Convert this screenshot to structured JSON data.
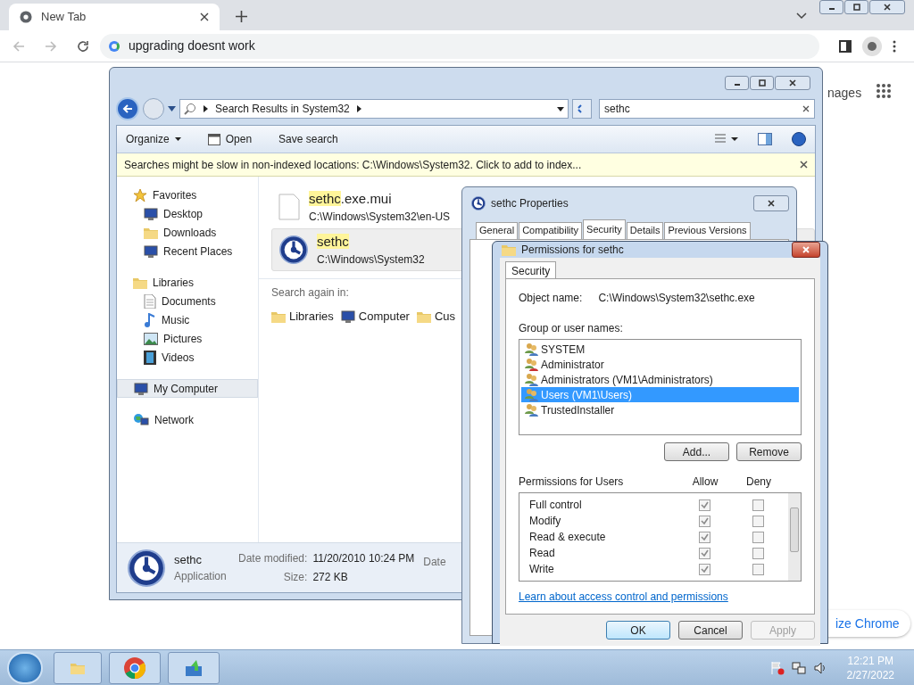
{
  "browser": {
    "tab": {
      "title": "New Tab"
    },
    "address": {
      "value": "upgrading doesnt work"
    },
    "page_texts": [
      {
        "kind": "top",
        "text": "nages"
      },
      {
        "kind": "pill",
        "text": "ize Chrome"
      }
    ]
  },
  "explorer": {
    "breadcrumb": "Search Results in System32",
    "search": {
      "value": "sethc"
    },
    "toolbar": [
      {
        "label": "Organize",
        "kind": "menu"
      },
      {
        "label": "Open",
        "kind": "icon"
      },
      {
        "label": "Save search",
        "kind": "plain"
      }
    ],
    "info_bar": "Searches might be slow in non-indexed locations: C:\\Windows\\System32. Click to add to index...",
    "nav": [
      {
        "label": "Favorites",
        "selected": false,
        "children": [
          {
            "label": "Desktop",
            "selected": false
          },
          {
            "label": "Downloads",
            "selected": false
          },
          {
            "label": "Recent Places",
            "selected": false
          }
        ]
      },
      {
        "label": "Libraries",
        "selected": false,
        "children": [
          {
            "label": "Documents",
            "selected": false
          },
          {
            "label": "Music",
            "selected": false
          },
          {
            "label": "Pictures",
            "selected": false
          },
          {
            "label": "Videos",
            "selected": false
          }
        ]
      },
      {
        "label": "My Computer",
        "selected": true
      },
      {
        "label": "Network",
        "selected": false
      }
    ],
    "results": [
      {
        "match": "sethc",
        "rest": ".exe.mui",
        "path": "C:\\Windows\\System32\\en-US",
        "kind": "file",
        "selected": false
      },
      {
        "match": "sethc",
        "path": "C:\\Windows\\System32",
        "kind": "app",
        "selected": true
      }
    ],
    "search_again": {
      "label": "Search again in:",
      "locations": [
        "Libraries",
        "Computer",
        "Cus"
      ]
    },
    "details": {
      "name": "sethc",
      "type": "Application",
      "fields": [
        {
          "label": "Date modified:",
          "value": "11/20/2010 10:24 PM"
        },
        {
          "label": "Size:",
          "value": "272 KB"
        }
      ],
      "cut_label": "Date"
    }
  },
  "properties": {
    "title": "sethc Properties",
    "tabs": [
      {
        "label": "General",
        "selected": false
      },
      {
        "label": "Compatibility",
        "selected": false
      },
      {
        "label": "Security",
        "selected": true
      },
      {
        "label": "Details",
        "selected": false
      },
      {
        "label": "Previous Versions",
        "selected": false
      }
    ]
  },
  "permissions": {
    "title": "Permissions for sethc",
    "tab": "Security",
    "object_label": "Object name:",
    "object_value": "C:\\Windows\\System32\\sethc.exe",
    "group_label": "Group or user names:",
    "users": [
      {
        "name": "SYSTEM",
        "selected": false
      },
      {
        "name": "Administrator",
        "selected": false
      },
      {
        "name": "Administrators (VM1\\Administrators)",
        "selected": false
      },
      {
        "name": "Users (VM1\\Users)",
        "selected": true
      },
      {
        "name": "TrustedInstaller",
        "selected": false
      }
    ],
    "list_buttons": [
      "Add...",
      "Remove"
    ],
    "perm_label": "Permissions for Users",
    "columns": [
      "Allow",
      "Deny"
    ],
    "rows": [
      {
        "name": "Full control",
        "allow": true,
        "deny": false
      },
      {
        "name": "Modify",
        "allow": true,
        "deny": false
      },
      {
        "name": "Read & execute",
        "allow": true,
        "deny": false
      },
      {
        "name": "Read",
        "allow": true,
        "deny": false
      },
      {
        "name": "Write",
        "allow": true,
        "deny": false
      }
    ],
    "link": "Learn about access control and permissions",
    "buttons": [
      {
        "label": "OK",
        "default": true,
        "disabled": false
      },
      {
        "label": "Cancel",
        "default": false,
        "disabled": false
      },
      {
        "label": "Apply",
        "default": false,
        "disabled": true
      }
    ]
  },
  "taskbar": {
    "time": "12:21 PM",
    "date": "2/27/2022"
  }
}
